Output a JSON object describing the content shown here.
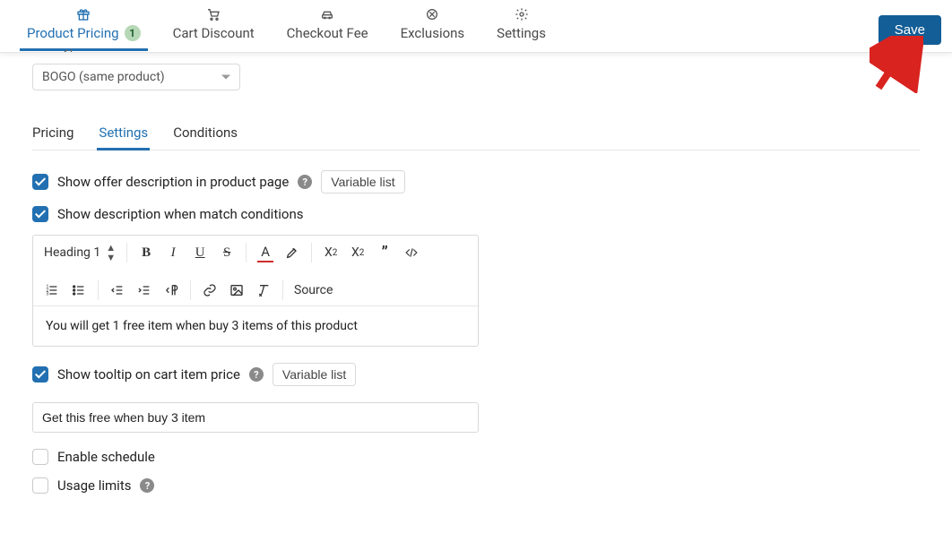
{
  "topnav": {
    "items": [
      {
        "label": "Product Pricing",
        "icon": "gift-icon",
        "badge": "1",
        "active": true
      },
      {
        "label": "Cart Discount",
        "icon": "cart-icon"
      },
      {
        "label": "Checkout Fee",
        "icon": "car-icon"
      },
      {
        "label": "Exclusions",
        "icon": "ban-icon"
      },
      {
        "label": "Settings",
        "icon": "gear-icon"
      }
    ],
    "save_label": "Save"
  },
  "rule_type": {
    "label": "Rule type",
    "selected": "BOGO (same product)"
  },
  "subtabs": {
    "items": [
      {
        "label": "Pricing"
      },
      {
        "label": "Settings",
        "active": true
      },
      {
        "label": "Conditions"
      }
    ]
  },
  "settings": {
    "show_offer_label": "Show offer description in product page",
    "variable_list_label": "Variable list",
    "show_desc_conditions_label": "Show description when match conditions",
    "editor": {
      "heading_label": "Heading 1",
      "source_label": "Source",
      "content": "You will get 1 free item when buy 3 items of this product"
    },
    "show_tooltip_label": "Show tooltip on cart item price",
    "tooltip_input_value": "Get this free when buy 3 item",
    "enable_schedule_label": "Enable schedule",
    "usage_limits_label": "Usage limits"
  }
}
